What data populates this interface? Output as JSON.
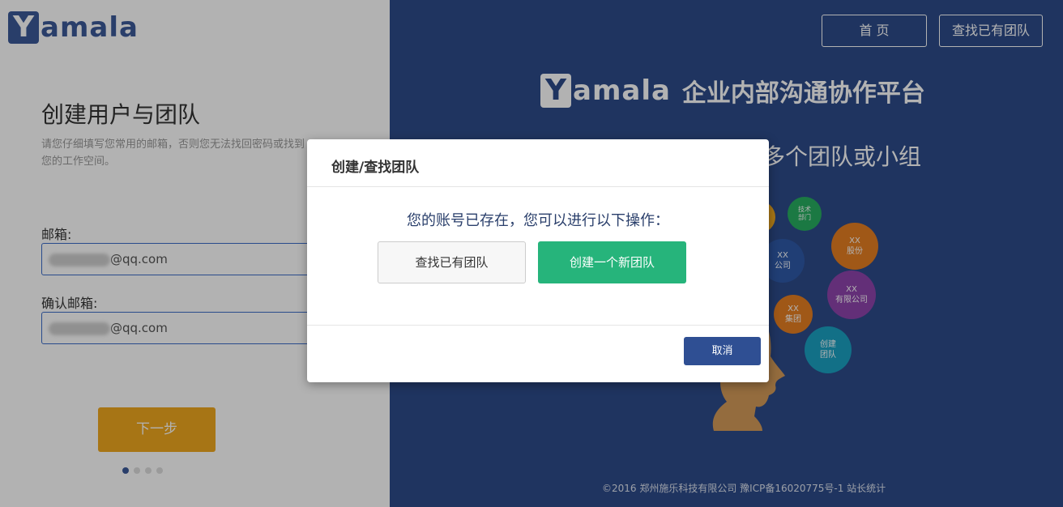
{
  "left": {
    "logo_y": "Y",
    "logo_text": "amala",
    "title": "创建用户与团队",
    "description": "请您仔细填写您常用的邮箱，否则您无法找回密码或找到\n您的工作空间。",
    "email_label": "邮箱:",
    "email_value": "@qq.com",
    "confirm_label": "确认邮箱:",
    "confirm_value": "@qq.com",
    "next_button": "下一步"
  },
  "right": {
    "nav_home": "首 页",
    "nav_find": "查找已有团队",
    "brand_y": "Y",
    "brand_text": "amala",
    "brand_sub": "企业内部沟通协作平台",
    "slogan": "多个团队或小组",
    "bubbles": [
      {
        "line1": "技术",
        "line2": "部门",
        "color": "#27ae60"
      },
      {
        "line1": "XX",
        "line2": "股份",
        "color": "#e67e22"
      },
      {
        "line1": "XX",
        "line2": "公司",
        "color": "#2f5aa8"
      },
      {
        "line1": "XX",
        "line2": "有限公司",
        "color": "#8e44ad"
      },
      {
        "line1": "XX",
        "line2": "集团",
        "color": "#e67e22"
      },
      {
        "line1": "创建",
        "line2": "团队",
        "color": "#1aa1c2"
      }
    ],
    "footer": "©2016 郑州施乐科技有限公司 豫ICP备16020775号-1 站长统计"
  },
  "modal": {
    "title": "创建/查找团队",
    "message": "您的账号已存在，您可以进行以下操作：",
    "find_button": "查找已有团队",
    "create_button": "创建一个新团队",
    "cancel_button": "取消"
  }
}
